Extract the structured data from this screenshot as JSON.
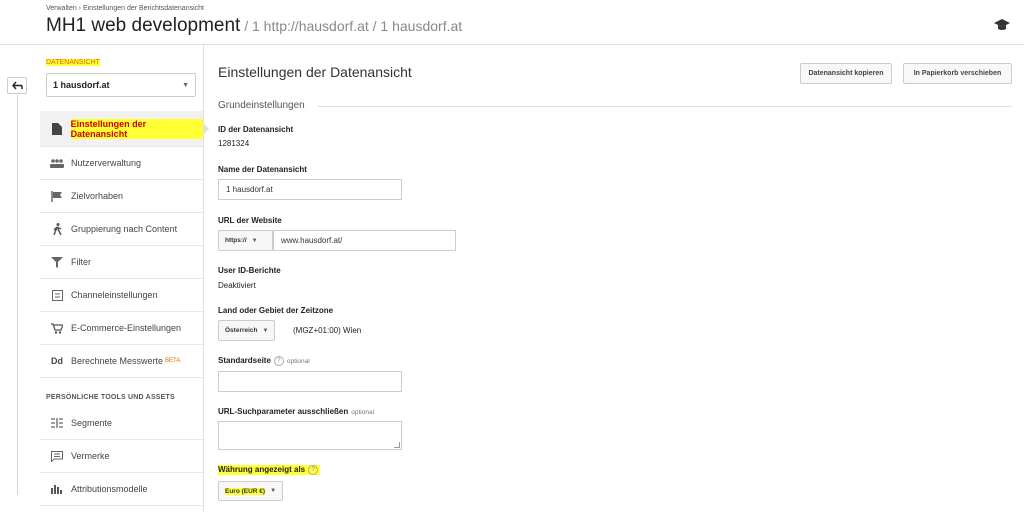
{
  "header": {
    "breadcrumb": "Verwalten  ›  Einstellungen der Berichtsdatenansicht",
    "title": "MH1 web development",
    "sep1": " / ",
    "account": "1 http://hausdorf.at",
    "sep2": " / ",
    "view": "1 hausdorf.at"
  },
  "sidebar": {
    "section_label": "DATENANSICHT",
    "view_select": "1 hausdorf.at",
    "items": [
      {
        "label": "Einstellungen der Datenansicht",
        "icon": "document-icon"
      },
      {
        "label": "Nutzerverwaltung",
        "icon": "users-icon"
      },
      {
        "label": "Zielvorhaben",
        "icon": "flag-icon"
      },
      {
        "label": "Gruppierung nach Content",
        "icon": "person-walk-icon"
      },
      {
        "label": "Filter",
        "icon": "filter-icon"
      },
      {
        "label": "Channeleinstellungen",
        "icon": "channel-icon"
      },
      {
        "label": "E-Commerce-Einstellungen",
        "icon": "cart-icon"
      },
      {
        "label": "Berechnete Messwerte",
        "badge": "BETA",
        "icon": "dd-icon"
      }
    ],
    "tools_heading": "PERSÖNLICHE TOOLS UND ASSETS",
    "tools": [
      {
        "label": "Segmente",
        "icon": "segments-icon"
      },
      {
        "label": "Vermerke",
        "icon": "comment-icon"
      },
      {
        "label": "Attributionsmodelle",
        "icon": "bar-chart-icon"
      }
    ]
  },
  "main": {
    "title": "Einstellungen der Datenansicht",
    "copy_button": "Datenansicht kopieren",
    "trash_button": "In Papierkorb verschieben",
    "section_heading": "Grundeinstellungen",
    "id_label": "ID der Datenansicht",
    "id_value": "1281324",
    "name_label": "Name der Datenansicht",
    "name_value": "1 hausdorf.at",
    "url_label": "URL der Website",
    "protocol": "https://",
    "url_value": "www.hausdorf.at/",
    "userid_label": "User ID-Berichte",
    "userid_value": "Deaktiviert",
    "timezone_label": "Land oder Gebiet der Zeitzone",
    "country": "Österreich",
    "timezone": "(MGZ+01:00) Wien",
    "default_page_label": "Standardseite",
    "optional": "optional",
    "exclude_label": "URL-Suchparameter ausschließen",
    "currency_label": "Währung angezeigt als",
    "currency_value": "Euro (EUR €)",
    "help": "?"
  },
  "colors": {
    "highlight": "#ffff33",
    "active_text": "#cc0000",
    "section_label": "#e06a00"
  }
}
